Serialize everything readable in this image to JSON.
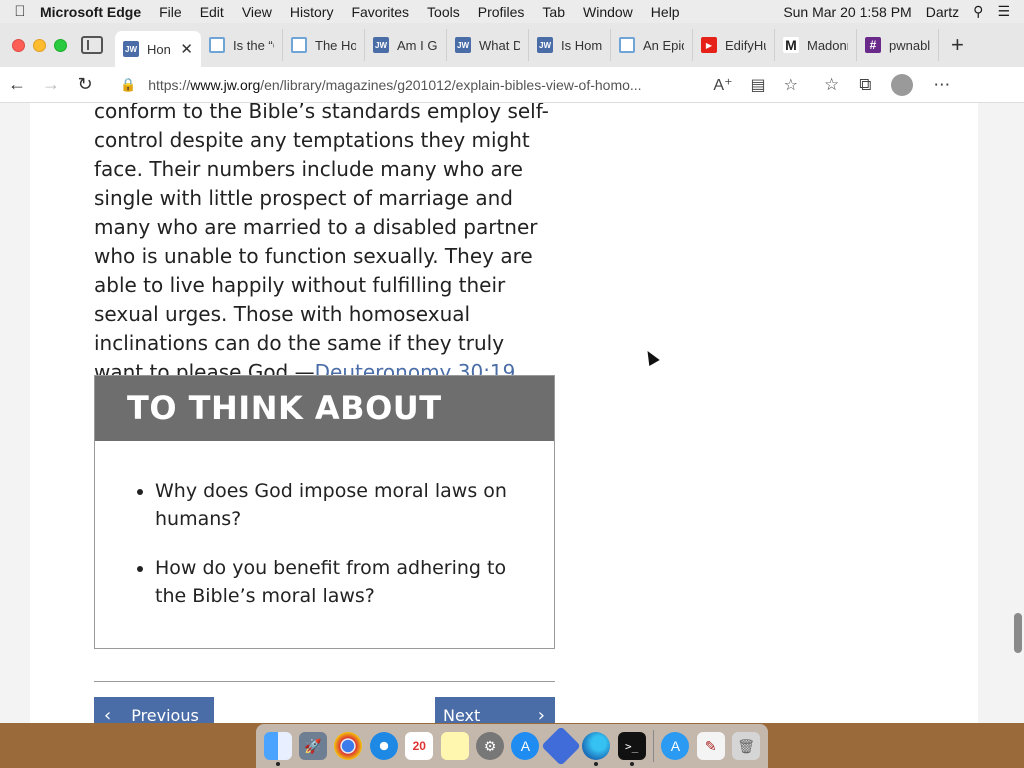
{
  "menubar": {
    "apple": "",
    "app_name": "Microsoft Edge",
    "items": [
      "File",
      "Edit",
      "View",
      "History",
      "Favorites",
      "Tools",
      "Profiles",
      "Tab",
      "Window",
      "Help"
    ],
    "clock": "Sun Mar 20  1:58 PM",
    "user": "Dartz"
  },
  "tabs": [
    {
      "title": "Hon",
      "icon": "jw-icon",
      "active": true
    },
    {
      "title": "Is the “C",
      "icon": "doc-icon"
    },
    {
      "title": "The Hor",
      "icon": "doc-icon"
    },
    {
      "title": "Am I Ga",
      "icon": "jw-icon"
    },
    {
      "title": "What Dc",
      "icon": "jw-icon"
    },
    {
      "title": "Is Homc",
      "icon": "jw-icon"
    },
    {
      "title": "An Epid",
      "icon": "doc-icon"
    },
    {
      "title": "EdifyHu",
      "icon": "youtube-icon"
    },
    {
      "title": "Madonn",
      "icon": "m-icon"
    },
    {
      "title": "pwnable",
      "icon": "hash-icon"
    }
  ],
  "address": {
    "url_prefix": "https://",
    "url_host": "www.jw.org",
    "url_path": "/en/library/magazines/g201012/explain-bibles-view-of-homo..."
  },
  "article": {
    "paragraph": "conform to the Bible’s standards employ self-control despite any temptations they might face. Their numbers include many who are single with little prospect of marriage and many who are married to a disabled partner who is unable to function sexually. They are able to live happily without fulfilling their sexual urges. Those with homosexual inclinations can do the same if they truly want to please God.—",
    "link": "Deuteronomy 30:19",
    "end": "."
  },
  "think_box": {
    "heading": "TO THINK ABOUT",
    "questions": [
      "Why does God impose moral laws on humans?",
      "How do you benefit from adhering to the Bible’s moral laws?"
    ]
  },
  "pager": {
    "previous": "Previous",
    "next": "Next"
  },
  "dock": {
    "calendar_day": "20"
  },
  "colors": {
    "accent": "#4a6da7",
    "box_header": "#6e6e6e"
  }
}
